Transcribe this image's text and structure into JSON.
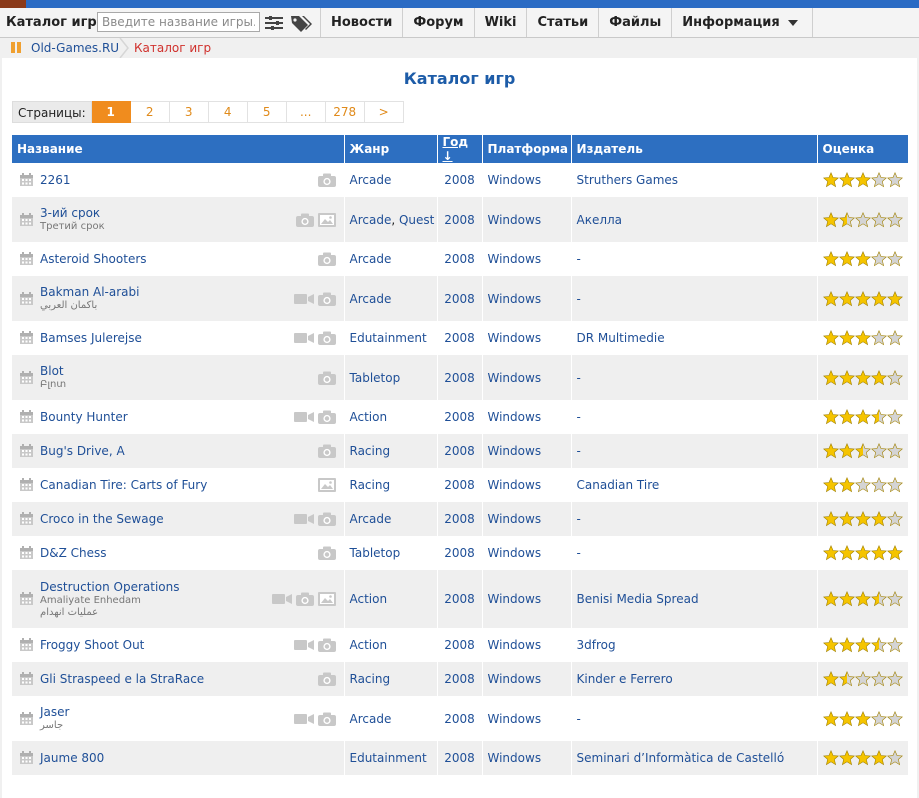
{
  "navbar": {
    "brand": "Каталог игр",
    "search_placeholder": "Введите название игры...",
    "menu": [
      "Новости",
      "Форум",
      "Wiki",
      "Статьи",
      "Файлы",
      "Информация"
    ]
  },
  "breadcrumb": {
    "home": "Old-Games.RU",
    "current": "Каталог игр"
  },
  "page_title": "Каталог игр",
  "pager": {
    "label": "Страницы:",
    "pages": [
      "1",
      "2",
      "3",
      "4",
      "5",
      "...",
      "278",
      ">"
    ],
    "active": "1"
  },
  "table": {
    "headers": {
      "name": "Название",
      "genre": "Жанр",
      "year": "Год ↓",
      "platform": "Платформа",
      "publisher": "Издатель",
      "rating": "Оценка"
    },
    "rows": [
      {
        "name": "2261",
        "sub": "",
        "sub2": "",
        "genre": "Arcade",
        "genre2": "",
        "year": "2008",
        "platform": "Windows",
        "publisher": "Struthers Games",
        "rating": 3,
        "media": [
          "camera"
        ]
      },
      {
        "name": "3-ий срок",
        "sub": "Третий срок",
        "sub2": "",
        "genre": "Arcade",
        "genre2": "Quest",
        "year": "2008",
        "platform": "Windows",
        "publisher": "Акелла",
        "rating": 1.5,
        "media": [
          "camera",
          "image"
        ]
      },
      {
        "name": "Asteroid Shooters",
        "sub": "",
        "sub2": "",
        "genre": "Arcade",
        "genre2": "",
        "year": "2008",
        "platform": "Windows",
        "publisher": "-",
        "rating": 3,
        "media": [
          "camera"
        ]
      },
      {
        "name": "Bakman Al-arabi",
        "sub": "باكمان العربي",
        "sub2": "",
        "genre": "Arcade",
        "genre2": "",
        "year": "2008",
        "platform": "Windows",
        "publisher": "-",
        "rating": 5,
        "media": [
          "video",
          "camera"
        ]
      },
      {
        "name": "Bamses Julerejse",
        "sub": "",
        "sub2": "",
        "genre": "Edutainment",
        "genre2": "",
        "year": "2008",
        "platform": "Windows",
        "publisher": "DR Multimedie",
        "rating": 3,
        "media": [
          "video",
          "camera"
        ]
      },
      {
        "name": "Blot",
        "sub": "Բլոտ",
        "sub2": "",
        "genre": "Tabletop",
        "genre2": "",
        "year": "2008",
        "platform": "Windows",
        "publisher": "-",
        "rating": 4,
        "media": [
          "camera"
        ]
      },
      {
        "name": "Bounty Hunter",
        "sub": "",
        "sub2": "",
        "genre": "Action",
        "genre2": "",
        "year": "2008",
        "platform": "Windows",
        "publisher": "-",
        "rating": 3.5,
        "media": [
          "video",
          "camera"
        ]
      },
      {
        "name": "Bug's Drive, A",
        "sub": "",
        "sub2": "",
        "genre": "Racing",
        "genre2": "",
        "year": "2008",
        "platform": "Windows",
        "publisher": "-",
        "rating": 2.5,
        "media": [
          "camera"
        ]
      },
      {
        "name": "Canadian Tire: Carts of Fury",
        "sub": "",
        "sub2": "",
        "genre": "Racing",
        "genre2": "",
        "year": "2008",
        "platform": "Windows",
        "publisher": "Canadian Tire",
        "rating": 2,
        "media": [
          "image"
        ]
      },
      {
        "name": "Croco in the Sewage",
        "sub": "",
        "sub2": "",
        "genre": "Arcade",
        "genre2": "",
        "year": "2008",
        "platform": "Windows",
        "publisher": "-",
        "rating": 4,
        "media": [
          "video",
          "camera"
        ]
      },
      {
        "name": "D&Z Chess",
        "sub": "",
        "sub2": "",
        "genre": "Tabletop",
        "genre2": "",
        "year": "2008",
        "platform": "Windows",
        "publisher": "-",
        "rating": 5,
        "media": [
          "camera"
        ]
      },
      {
        "name": "Destruction Operations",
        "sub": "Amaliyate Enhedam",
        "sub2": "عمليات انهدام",
        "genre": "Action",
        "genre2": "",
        "year": "2008",
        "platform": "Windows",
        "publisher": "Benisi Media Spread",
        "rating": 3.5,
        "media": [
          "video",
          "camera",
          "image"
        ]
      },
      {
        "name": "Froggy Shoot Out",
        "sub": "",
        "sub2": "",
        "genre": "Action",
        "genre2": "",
        "year": "2008",
        "platform": "Windows",
        "publisher": "3dfrog",
        "rating": 3.5,
        "media": [
          "video",
          "camera"
        ]
      },
      {
        "name": "Gli Straspeed e la StraRace",
        "sub": "",
        "sub2": "",
        "genre": "Racing",
        "genre2": "",
        "year": "2008",
        "platform": "Windows",
        "publisher": "Kinder e Ferrero",
        "rating": 1.5,
        "media": [
          "camera"
        ]
      },
      {
        "name": "Jaser",
        "sub": "جاسر",
        "sub2": "",
        "genre": "Arcade",
        "genre2": "",
        "year": "2008",
        "platform": "Windows",
        "publisher": "-",
        "rating": 3,
        "media": [
          "video",
          "camera"
        ]
      },
      {
        "name": "Jaume 800",
        "sub": "",
        "sub2": "",
        "genre": "Edutainment",
        "genre2": "",
        "year": "2008",
        "platform": "Windows",
        "publisher": "Seminari d’Informàtica de Castelló",
        "rating": 4,
        "media": []
      }
    ]
  },
  "colors": {
    "accent": "#2d6fc1",
    "link": "#1f4f97",
    "pager_active": "#f08c1e",
    "star": "#f5c400"
  }
}
